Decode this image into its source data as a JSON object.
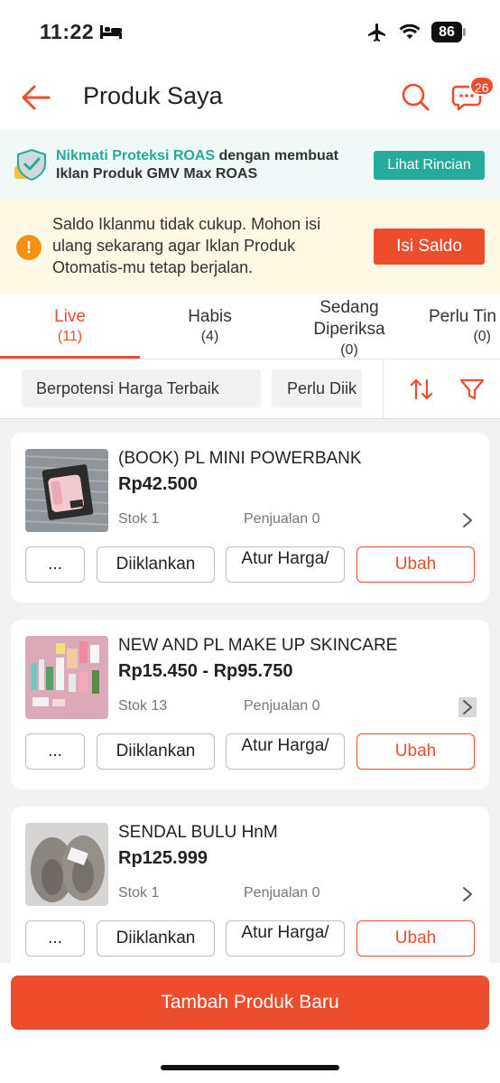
{
  "status_bar": {
    "time": "11:22",
    "battery": "86"
  },
  "header": {
    "title": "Produk Saya",
    "chat_badge": "26"
  },
  "roas_banner": {
    "highlight": "Nikmati Proteksi ROAS",
    "text": " dengan membuat Iklan Produk GMV Max ROAS",
    "button": "Lihat Rincian"
  },
  "saldo_banner": {
    "text": "Saldo Iklanmu tidak cukup. Mohon isi ulang sekarang agar Iklan Produk Otomatis-mu tetap berjalan.",
    "button": "Isi Saldo"
  },
  "tabs": [
    {
      "label": "Live",
      "count": "(11)",
      "active": true
    },
    {
      "label": "Habis",
      "count": "(4)",
      "active": false
    },
    {
      "label": "Sedang Diperiksa",
      "count": "(0)",
      "active": false
    },
    {
      "label": "Perlu Tin",
      "count": "(0)",
      "active": false
    }
  ],
  "filters": {
    "chips": [
      "Berpotensi Harga Terbaik",
      "Perlu Diik"
    ]
  },
  "products": [
    {
      "name": "(BOOK) PL MINI POWERBANK",
      "price": "Rp42.500",
      "stok": "Stok 1",
      "sold": "Penjualan 0",
      "btn_more": "...",
      "btn_iklan": "Diiklankan",
      "btn_harga": "Atur Harga/",
      "btn_ubah": "Ubah"
    },
    {
      "name": "NEW AND PL MAKE UP SKINCARE",
      "price": "Rp15.450 - Rp95.750",
      "stok": "Stok 13",
      "sold": "Penjualan 0",
      "btn_more": "...",
      "btn_iklan": "Diiklankan",
      "btn_harga": "Atur Harga/",
      "btn_ubah": "Ubah"
    },
    {
      "name": "SENDAL BULU HnM",
      "price": "Rp125.999",
      "stok": "Stok 1",
      "sold": "Penjualan 0",
      "btn_more": "...",
      "btn_iklan": "Diiklankan",
      "btn_harga": "Atur Harga/",
      "btn_ubah": "Ubah"
    }
  ],
  "bottom": {
    "add_button": "Tambah Produk Baru"
  },
  "colors": {
    "accent": "#ee4d2d",
    "teal": "#26aa99",
    "warning": "#f69113"
  }
}
